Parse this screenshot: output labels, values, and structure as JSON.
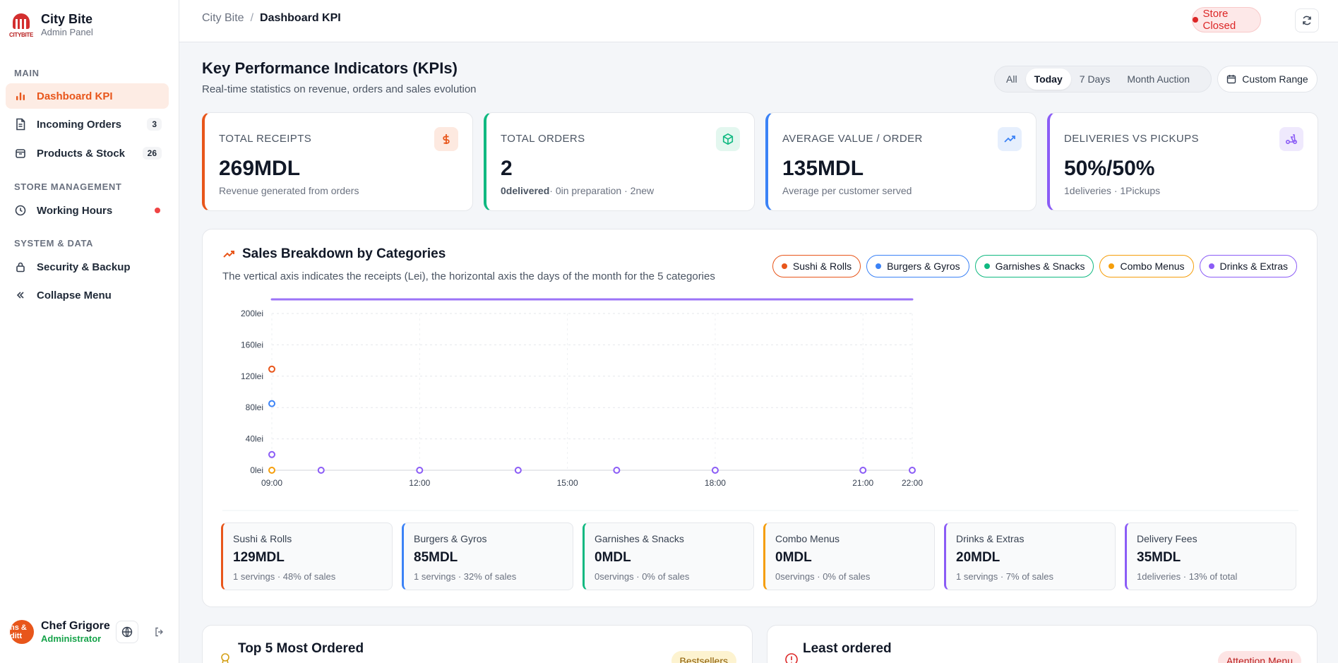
{
  "brand": {
    "name": "City Bite",
    "subtitle": "Admin Panel",
    "logo_text": "CITYBITE"
  },
  "sidebar": {
    "sections": {
      "main": "MAIN",
      "store": "STORE MANAGEMENT",
      "system": "SYSTEM & DATA"
    },
    "items": [
      {
        "label": "Dashboard KPI",
        "icon": "bar-chart-icon",
        "active": true
      },
      {
        "label": "Incoming Orders",
        "icon": "document-icon",
        "badge": "3"
      },
      {
        "label": "Products & Stock",
        "icon": "box-icon",
        "badge": "26"
      },
      {
        "label": "Working Hours",
        "icon": "clock-icon",
        "status_dot": "#ef4444"
      },
      {
        "label": "Security & Backup",
        "icon": "lock-icon"
      },
      {
        "label": "Collapse Menu",
        "icon": "double-chevron-left-icon"
      }
    ],
    "user": {
      "name": "Chef Grigore",
      "role": "Administrator",
      "avatar_text": "ns & ditt"
    }
  },
  "topbar": {
    "breadcrumb_root": "City Bite",
    "breadcrumb_separator": "/",
    "breadcrumb_current": "Dashboard KPI",
    "store_status": "Store Closed"
  },
  "header": {
    "title": "Key Performance Indicators (KPIs)",
    "subtitle": "Real-time statistics on revenue, orders and sales evolution",
    "filters": [
      "All",
      "Today",
      "7 Days",
      "Month Auction"
    ],
    "selected_filter": "Today",
    "custom_range": "Custom Range"
  },
  "kpis": [
    {
      "label": "TOTAL RECEIPTS",
      "value": "269MDL",
      "note": "Revenue generated from orders",
      "accent": "#e8561b",
      "icon": "dollar-icon"
    },
    {
      "label": "TOTAL ORDERS",
      "value": "2",
      "note_strong": "0delivered",
      "note": "· 0in preparation · 2new",
      "accent": "#10b981",
      "icon": "package-icon"
    },
    {
      "label": "AVERAGE VALUE / ORDER",
      "value": "135MDL",
      "note": "Average per customer served",
      "accent": "#3b82f6",
      "icon": "trending-up-icon"
    },
    {
      "label": "DELIVERIES VS PICKUPS",
      "value": "50%/50%",
      "note": "1deliveries · 1Pickups",
      "accent": "#8b5cf6",
      "icon": "scooter-icon"
    }
  ],
  "sales": {
    "title": "Sales Breakdown by Categories",
    "subtitle": "The vertical axis indicates the receipts (Lei), the horizontal axis the days of the month for the 5 categories",
    "legend": [
      {
        "name": "Sushi & Rolls",
        "color": "#e8561b"
      },
      {
        "name": "Burgers & Gyros",
        "color": "#3b82f6"
      },
      {
        "name": "Garnishes & Snacks",
        "color": "#10b981"
      },
      {
        "name": "Combo Menus",
        "color": "#f59e0b"
      },
      {
        "name": "Drinks & Extras",
        "color": "#8b5cf6"
      }
    ],
    "cards": [
      {
        "name": "Sushi & Rolls",
        "value": "129MDL",
        "note": "1 servings · 48% of sales",
        "color": "#e8561b"
      },
      {
        "name": "Burgers & Gyros",
        "value": "85MDL",
        "note": "1 servings · 32% of sales",
        "color": "#3b82f6"
      },
      {
        "name": "Garnishes & Snacks",
        "value": "0MDL",
        "note": "0servings · 0% of sales",
        "color": "#10b981"
      },
      {
        "name": "Combo Menus",
        "value": "0MDL",
        "note": "0servings · 0% of sales",
        "color": "#f59e0b"
      },
      {
        "name": "Drinks & Extras",
        "value": "20MDL",
        "note": "1 servings · 7% of sales",
        "color": "#8b5cf6"
      },
      {
        "name": "Delivery Fees",
        "value": "35MDL",
        "note": "1deliveries · 13% of total",
        "color": "#8b5cf6"
      }
    ]
  },
  "chart_data": {
    "type": "scatter",
    "xlabel": "",
    "ylabel": "",
    "x_ticks": [
      "09:00",
      "12:00",
      "15:00",
      "18:00",
      "21:00",
      "22:00"
    ],
    "y_ticks": [
      "0lei",
      "40lei",
      "80lei",
      "120lei",
      "160lei",
      "200lei"
    ],
    "ylim": [
      0,
      200
    ],
    "grid": true,
    "series": [
      {
        "name": "Sushi & Rolls",
        "color": "#e8561b",
        "points": [
          [
            "09:00",
            129
          ]
        ]
      },
      {
        "name": "Burgers & Gyros",
        "color": "#3b82f6",
        "points": [
          [
            "09:00",
            85
          ]
        ]
      },
      {
        "name": "Combo Menus",
        "color": "#f59e0b",
        "points": [
          [
            "09:00",
            0
          ]
        ]
      },
      {
        "name": "Drinks & Extras",
        "color": "#8b5cf6",
        "points": [
          [
            "09:00",
            20
          ],
          [
            "10:00",
            0
          ],
          [
            "12:00",
            0
          ],
          [
            "14:00",
            0
          ],
          [
            "16:00",
            0
          ],
          [
            "18:00",
            0
          ],
          [
            "21:00",
            0
          ],
          [
            "22:00",
            0
          ]
        ]
      }
    ]
  },
  "bottom": {
    "top5_title": "Top 5 Most Ordered",
    "top5_badge": "Bestsellers",
    "least_title": "Least ordered",
    "least_badge": "Attention Menu"
  }
}
